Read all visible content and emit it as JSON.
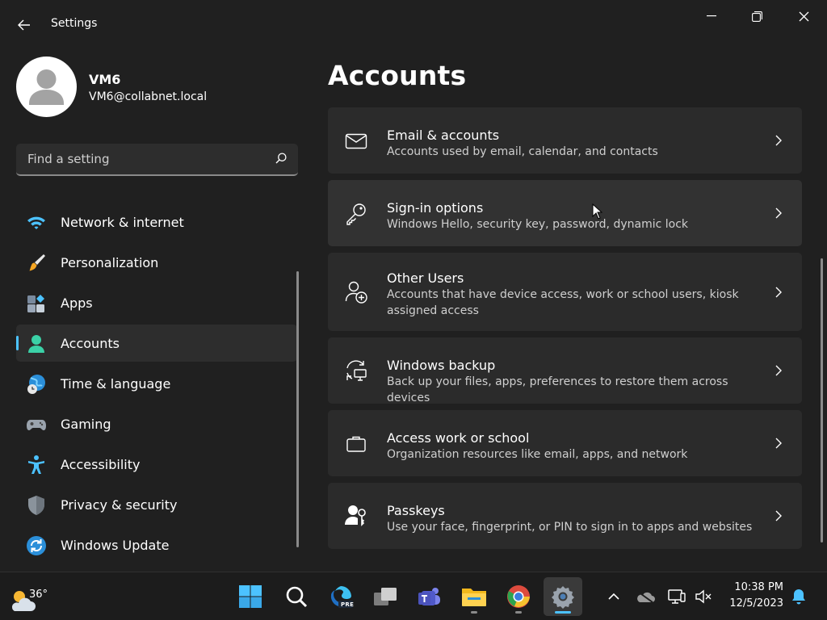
{
  "window": {
    "app_title": "Settings",
    "back_icon": "back-arrow-icon",
    "controls": [
      "minimize-icon",
      "restore-icon",
      "close-icon"
    ]
  },
  "profile": {
    "name": "VM6",
    "email": "VM6@collabnet.local"
  },
  "search": {
    "placeholder": "Find a setting",
    "value": ""
  },
  "sidebar": {
    "items": [
      {
        "label": "Network & internet",
        "icon": "wifi-icon",
        "selected": false
      },
      {
        "label": "Personalization",
        "icon": "paintbrush-icon",
        "selected": false
      },
      {
        "label": "Apps",
        "icon": "apps-icon",
        "selected": false
      },
      {
        "label": "Accounts",
        "icon": "person-icon",
        "selected": true
      },
      {
        "label": "Time & language",
        "icon": "globe-clock-icon",
        "selected": false
      },
      {
        "label": "Gaming",
        "icon": "gamepad-icon",
        "selected": false
      },
      {
        "label": "Accessibility",
        "icon": "accessibility-icon",
        "selected": false
      },
      {
        "label": "Privacy & security",
        "icon": "shield-icon",
        "selected": false
      },
      {
        "label": "Windows Update",
        "icon": "update-icon",
        "selected": false
      }
    ]
  },
  "main": {
    "title": "Accounts",
    "cards": [
      {
        "title": "Email & accounts",
        "subtitle": "Accounts used by email, calendar, and contacts",
        "icon": "mail-icon"
      },
      {
        "title": "Sign-in options",
        "subtitle": "Windows Hello, security key, password, dynamic lock",
        "icon": "key-icon"
      },
      {
        "title": "Other Users",
        "subtitle": "Accounts that have device access, work or school users, kiosk assigned access",
        "icon": "person-add-icon"
      },
      {
        "title": "Windows backup",
        "subtitle": "Back up your files, apps, preferences to restore them across devices",
        "icon": "backup-icon"
      },
      {
        "title": "Access work or school",
        "subtitle": "Organization resources like email, apps, and network",
        "icon": "briefcase-icon"
      },
      {
        "title": "Passkeys",
        "subtitle": "Use your face, fingerprint, or PIN to sign in to apps and websites",
        "icon": "passkey-icon"
      }
    ]
  },
  "taskbar": {
    "weather_temp": "36°",
    "pre_badge": "PRE",
    "apps": [
      "start-icon",
      "search-icon",
      "edge-preview-icon",
      "task-view-icon",
      "teams-icon",
      "file-explorer-icon",
      "chrome-icon",
      "settings-icon"
    ],
    "tray": [
      "chevron-up-icon",
      "onedrive-icon",
      "network-icon",
      "volume-muted-icon"
    ],
    "time": "10:38 PM",
    "date": "12/5/2023",
    "notification_icon": "bell-icon"
  },
  "colors": {
    "accent": "#4cc2ff",
    "background": "#202020",
    "card": "#2b2b2b",
    "taskbar": "#1c1c1c"
  }
}
